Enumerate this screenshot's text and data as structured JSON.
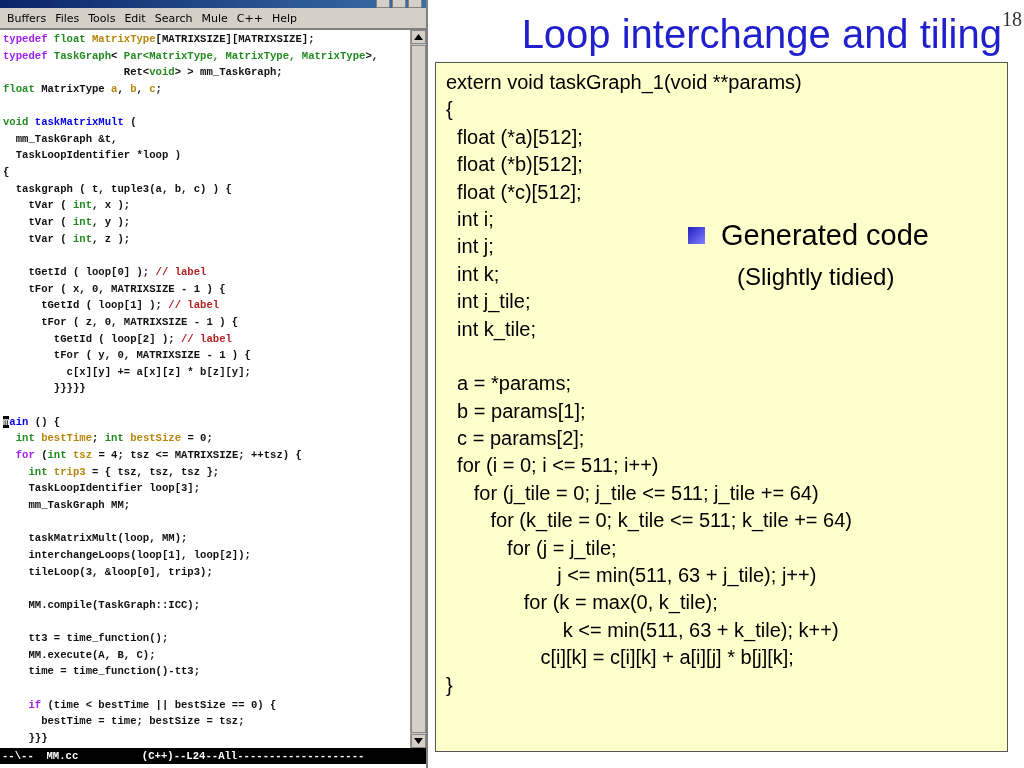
{
  "editor": {
    "menu": [
      "Buffers",
      "Files",
      "Tools",
      "Edit",
      "Search",
      "Mule",
      "C++",
      "Help"
    ],
    "lines": [
      {
        "spans": [
          {
            "t": "typedef ",
            "kind": "kw"
          },
          {
            "t": "float ",
            "kind": "type"
          },
          {
            "t": "MatrixType",
            "kind": "var"
          },
          {
            "t": "[MATRIXSIZE][MATRIXSIZE];"
          }
        ]
      },
      {
        "spans": [
          {
            "t": "typedef ",
            "kind": "kw"
          },
          {
            "t": "TaskGraph",
            "kind": "type"
          },
          {
            "t": "< "
          },
          {
            "t": "Par<MatrixType, MatrixType, MatrixType",
            "kind": "type"
          },
          {
            "t": ">,"
          }
        ]
      },
      {
        "spans": [
          {
            "t": "                   Ret<"
          },
          {
            "t": "void",
            "kind": "type"
          },
          {
            "t": "> > mm_TaskGraph;"
          }
        ]
      },
      {
        "spans": [
          {
            "t": "float",
            "kind": "type"
          },
          {
            "t": " MatrixType "
          },
          {
            "t": "a",
            "kind": "var"
          },
          {
            "t": ", "
          },
          {
            "t": "b",
            "kind": "var"
          },
          {
            "t": ", "
          },
          {
            "t": "c",
            "kind": "var"
          },
          {
            "t": ";"
          }
        ]
      },
      {
        "blank_before": true,
        "spans": [
          {
            "t": "void ",
            "kind": "type"
          },
          {
            "t": "taskMatrixMult",
            "kind": "fn"
          },
          {
            "t": " ("
          }
        ]
      },
      {
        "spans": [
          {
            "t": "  mm_TaskGraph &t,"
          }
        ]
      },
      {
        "spans": [
          {
            "t": "  TaskLoopIdentifier *loop )"
          }
        ]
      },
      {
        "spans": [
          {
            "t": "{"
          }
        ]
      },
      {
        "spans": [
          {
            "t": "  taskgraph ( t, tuple3(a, b, c) ) {"
          }
        ]
      },
      {
        "spans": [
          {
            "t": "    tVar ( "
          },
          {
            "t": "int",
            "kind": "type"
          },
          {
            "t": ", x );"
          }
        ]
      },
      {
        "spans": [
          {
            "t": "    tVar ( "
          },
          {
            "t": "int",
            "kind": "type"
          },
          {
            "t": ", y );"
          }
        ]
      },
      {
        "spans": [
          {
            "t": "    tVar ( "
          },
          {
            "t": "int",
            "kind": "type"
          },
          {
            "t": ", z );"
          }
        ]
      },
      {
        "blank_before": true,
        "spans": [
          {
            "t": "    tGetId ( loop[0] ); "
          },
          {
            "t": "// label",
            "kind": "cm"
          }
        ]
      },
      {
        "spans": [
          {
            "t": "    tFor ( x, 0, MATRIXSIZE - 1 ) {"
          }
        ]
      },
      {
        "spans": [
          {
            "t": "      tGetId ( loop[1] ); "
          },
          {
            "t": "// label",
            "kind": "cm"
          }
        ]
      },
      {
        "spans": [
          {
            "t": "      tFor ( z, 0, MATRIXSIZE - 1 ) {"
          }
        ]
      },
      {
        "spans": [
          {
            "t": "        tGetId ( loop[2] ); "
          },
          {
            "t": "// label",
            "kind": "cm"
          }
        ]
      },
      {
        "spans": [
          {
            "t": "        tFor ( y, 0, MATRIXSIZE - 1 ) {"
          }
        ]
      },
      {
        "spans": [
          {
            "t": "          c[x][y] += a[x][z] * b[z][y];"
          }
        ]
      },
      {
        "spans": [
          {
            "t": "        }}}}}"
          }
        ]
      },
      {
        "blank_before": true,
        "spans": [
          {
            "t": "m",
            "kind": "cursor"
          },
          {
            "t": "ain",
            "kind": "fn"
          },
          {
            "t": " () {"
          }
        ]
      },
      {
        "spans": [
          {
            "t": "  int ",
            "kind": "type"
          },
          {
            "t": "bestTime",
            "kind": "var"
          },
          {
            "t": "; "
          },
          {
            "t": "int ",
            "kind": "type"
          },
          {
            "t": "bestSize",
            "kind": "var"
          },
          {
            "t": " = 0;"
          }
        ]
      },
      {
        "spans": [
          {
            "t": "  for",
            "kind": "kw"
          },
          {
            "t": " ("
          },
          {
            "t": "int ",
            "kind": "type"
          },
          {
            "t": "tsz",
            "kind": "var"
          },
          {
            "t": " = 4; tsz <= MATRIXSIZE; ++tsz) {"
          }
        ]
      },
      {
        "spans": [
          {
            "t": "    int ",
            "kind": "type"
          },
          {
            "t": "trip3",
            "kind": "var"
          },
          {
            "t": " = { tsz, tsz, tsz };"
          }
        ]
      },
      {
        "spans": [
          {
            "t": "    TaskLoopIdentifier loop[3];"
          }
        ]
      },
      {
        "spans": [
          {
            "t": "    mm_TaskGraph MM;"
          }
        ]
      },
      {
        "blank_before": true,
        "spans": [
          {
            "t": "    taskMatrixMult(loop, MM);"
          }
        ]
      },
      {
        "spans": [
          {
            "t": "    interchangeLoops(loop[1], loop[2]);"
          }
        ]
      },
      {
        "spans": [
          {
            "t": "    tileLoop(3, &loop[0], trip3);"
          }
        ]
      },
      {
        "blank_before": true,
        "spans": [
          {
            "t": "    MM.compile(TaskGraph::ICC);"
          }
        ]
      },
      {
        "blank_before": true,
        "spans": [
          {
            "t": "    tt3 = time_function();"
          }
        ]
      },
      {
        "spans": [
          {
            "t": "    MM.execute(A, B, C);"
          }
        ]
      },
      {
        "spans": [
          {
            "t": "    time = time_function()-tt3;"
          }
        ]
      },
      {
        "blank_before": true,
        "spans": [
          {
            "t": "    if",
            "kind": "kw"
          },
          {
            "t": " (time < bestTime || bestSize == 0) {"
          }
        ]
      },
      {
        "spans": [
          {
            "t": "      bestTime = time; bestSize = tsz;"
          }
        ]
      },
      {
        "spans": [
          {
            "t": "    }}}"
          }
        ]
      }
    ],
    "mode_line": "--\\--  MM.cc          (C++)--L24--All--------------------"
  },
  "slide": {
    "title": "Loop interchange and tiling",
    "page_number": "18",
    "code": [
      {
        "text": "extern void taskGraph_1(void **params)"
      },
      {
        "text": "{"
      },
      {
        "text": "  float (*a)[512];"
      },
      {
        "text": "  float (*b)[512];"
      },
      {
        "text": "  float (*c)[512];"
      },
      {
        "text": "  int i;"
      },
      {
        "text": "  int j;"
      },
      {
        "text": "  int k;"
      },
      {
        "text": "  int j_tile;"
      },
      {
        "text": "  int k_tile;"
      },
      {
        "text": "  a = *params;",
        "blank_before": true
      },
      {
        "text": "  b = params[1];"
      },
      {
        "text": "  c = params[2];"
      },
      {
        "text": "  for (i = 0; i <= 511; i++)"
      },
      {
        "text": "     for (j_tile = 0; j_tile <= 511; j_tile += 64)"
      },
      {
        "text": "        for (k_tile = 0; k_tile <= 511; k_tile += 64)"
      },
      {
        "text": "           for (j = j_tile;"
      },
      {
        "text": "                    j <= min(511, 63 + j_tile); j++)"
      },
      {
        "text": "              for (k = max(0, k_tile);"
      },
      {
        "text": "                     k <= min(511, 63 + k_tile); k++)"
      },
      {
        "text": "                 c[i][k] = c[i][k] + a[i][j] * b[j][k];"
      },
      {
        "text": "}"
      }
    ],
    "bullet": "Generated code",
    "note": "(Slightly tidied)"
  }
}
